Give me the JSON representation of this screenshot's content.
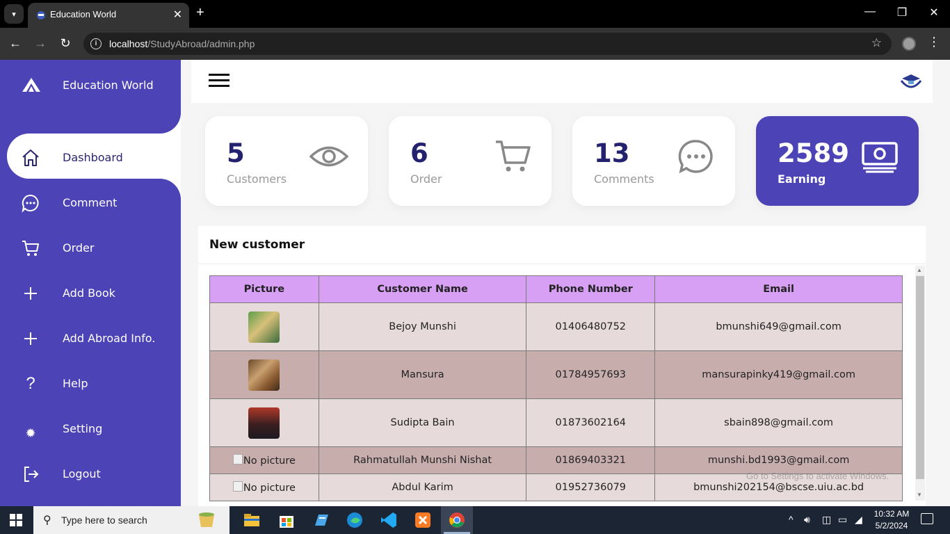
{
  "browser": {
    "tab_title": "Education World",
    "url_host": "localhost",
    "url_path": "/StudyAbroad/admin.php"
  },
  "sidebar": {
    "brand": "Education World",
    "items": [
      {
        "label": "Dashboard",
        "icon": "home-icon"
      },
      {
        "label": "Comment",
        "icon": "chat-icon"
      },
      {
        "label": "Order",
        "icon": "cart-icon"
      },
      {
        "label": "Add Book",
        "icon": "plus-icon"
      },
      {
        "label": "Add Abroad Info.",
        "icon": "plus-icon"
      },
      {
        "label": "Help",
        "icon": "question-icon"
      },
      {
        "label": "Setting",
        "icon": "gear-icon"
      },
      {
        "label": "Logout",
        "icon": "logout-icon"
      }
    ],
    "active": "Dashboard",
    "color": "#4c43b6"
  },
  "cards": [
    {
      "number": "5",
      "caption": "Customers",
      "icon": "eye-icon"
    },
    {
      "number": "6",
      "caption": "Order",
      "icon": "cart-icon"
    },
    {
      "number": "13",
      "caption": "Comments",
      "icon": "chat-icon"
    },
    {
      "number": "2589",
      "caption": "Earning",
      "icon": "money-icon"
    }
  ],
  "panel": {
    "title": "New customer",
    "headers": [
      "Picture",
      "Customer Name",
      "Phone Number",
      "Email"
    ],
    "rows": [
      {
        "picture": "photo",
        "name": "Bejoy Munshi",
        "phone": "01406480752",
        "email": "bmunshi649@gmail.com"
      },
      {
        "picture": "photo",
        "name": "Mansura",
        "phone": "01784957693",
        "email": "mansurapinky419@gmail.com"
      },
      {
        "picture": "photo",
        "name": "Sudipta Bain",
        "phone": "01873602164",
        "email": "sbain898@gmail.com"
      },
      {
        "picture": "No picture",
        "name": "Rahmatullah Munshi Nishat",
        "phone": "01869403321",
        "email": "munshi.bd1993@gmail.com"
      },
      {
        "picture": "No picture",
        "name": "Abdul Karim",
        "phone": "01952736079",
        "email": "bmunshi202154@bscse.uiu.ac.bd"
      }
    ],
    "header_color": "#d7a0f5"
  },
  "watermark": "Go to Settings to activate Windows.",
  "taskbar": {
    "search_placeholder": "Type here to search",
    "time": "10:32 AM",
    "date": "5/2/2024"
  }
}
